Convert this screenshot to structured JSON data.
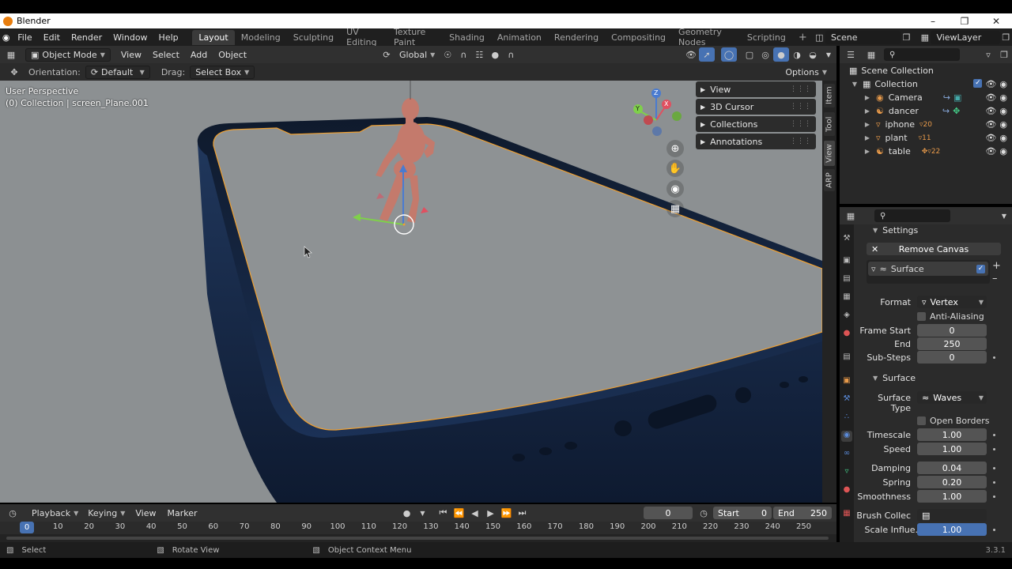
{
  "window": {
    "title": "Blender"
  },
  "menu": {
    "items": [
      "File",
      "Edit",
      "Render",
      "Window",
      "Help"
    ],
    "workspaces": [
      "Layout",
      "Modeling",
      "Sculpting",
      "UV Editing",
      "Texture Paint",
      "Shading",
      "Animation",
      "Rendering",
      "Compositing",
      "Geometry Nodes",
      "Scripting"
    ],
    "active_workspace": "Layout",
    "scene": "Scene",
    "view_layer": "ViewLayer"
  },
  "viewport_header": {
    "mode": "Object Mode",
    "menus": [
      "View",
      "Select",
      "Add",
      "Object"
    ],
    "transform": "Global"
  },
  "tool_header": {
    "orientation_label": "Orientation:",
    "orientation": "Default",
    "drag_label": "Drag:",
    "drag": "Select Box",
    "options": "Options"
  },
  "viewport": {
    "perspective": "User Perspective",
    "collection_info": "(0) Collection | screen_Plane.001",
    "gizmo": {
      "x": "X",
      "y": "Y",
      "z": "Z"
    },
    "panels": [
      "View",
      "3D Cursor",
      "Collections",
      "Annotations"
    ],
    "side_tabs": [
      "Item",
      "Tool",
      "View",
      "ARP"
    ]
  },
  "outliner": {
    "root": "Scene Collection",
    "collection": "Collection",
    "items": [
      {
        "name": "Camera",
        "badge": ""
      },
      {
        "name": "dancer",
        "badge": ""
      },
      {
        "name": "iphone",
        "badge": "20"
      },
      {
        "name": "plant",
        "badge": "11"
      },
      {
        "name": "table",
        "badge": "22"
      }
    ]
  },
  "properties": {
    "settings_header": "Settings",
    "remove_canvas": "Remove Canvas",
    "surface_slot": "Surface",
    "format_label": "Format",
    "format": "Vertex",
    "anti_aliasing": "Anti-Aliasing",
    "frame_start_label": "Frame Start",
    "frame_start": "0",
    "end_label": "End",
    "end": "250",
    "substeps_label": "Sub-Steps",
    "substeps": "0",
    "surface_header": "Surface",
    "surface_type_label": "Surface Type",
    "surface_type": "Waves",
    "open_borders": "Open Borders",
    "timescale_label": "Timescale",
    "timescale": "1.00",
    "speed_label": "Speed",
    "speed": "1.00",
    "damping_label": "Damping",
    "damping": "0.04",
    "spring_label": "Spring",
    "spring": "0.20",
    "smoothness_label": "Smoothness",
    "smoothness": "1.00",
    "brush_label": "Brush Collec",
    "scale_label": "Scale Influe...",
    "scale": "1.00"
  },
  "timeline": {
    "menus": [
      "Playback",
      "Keying",
      "View",
      "Marker"
    ],
    "current_frame": "0",
    "start_label": "Start",
    "start": "0",
    "end_label": "End",
    "end": "250",
    "ticks": [
      "0",
      "10",
      "20",
      "30",
      "40",
      "50",
      "60",
      "70",
      "80",
      "90",
      "100",
      "110",
      "120",
      "130",
      "140",
      "150",
      "160",
      "170",
      "180",
      "190",
      "200",
      "210",
      "220",
      "230",
      "240",
      "250"
    ]
  },
  "statusbar": {
    "select": "Select",
    "rotate": "Rotate View",
    "context": "Object Context Menu",
    "version": "3.3.1"
  },
  "colors": {
    "accent": "#4772b3",
    "selection_outline": "#f0a030",
    "brand": "#e87d0d"
  }
}
